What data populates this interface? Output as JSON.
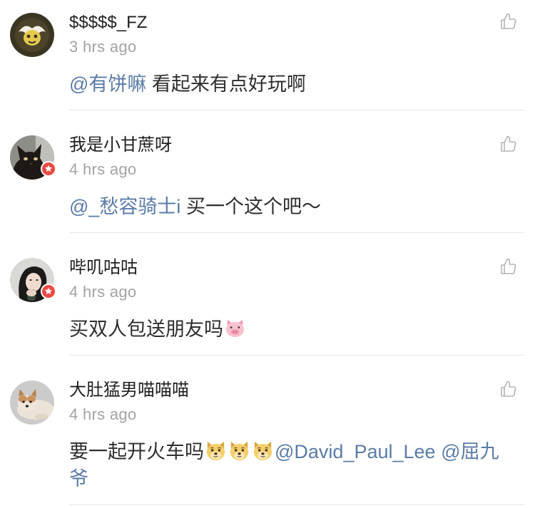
{
  "colors": {
    "mention": "#5a7ba8",
    "username": "#1f1f1f",
    "time": "#a3a3a3",
    "text": "#2e2e2e",
    "divider": "#e6e6e6",
    "badge": "#ea4a43"
  },
  "icons": {
    "like": "thumbs-up-icon",
    "verified": "verified-star-icon"
  },
  "comments": [
    {
      "username": "$$$$$_FZ",
      "time": "3 hrs ago",
      "verified": false,
      "body": [
        {
          "kind": "mention",
          "text": "@有饼嘛"
        },
        {
          "kind": "text",
          "text": " 看起来有点好玩啊"
        }
      ]
    },
    {
      "username": "我是小甘蔗呀",
      "time": "4 hrs ago",
      "verified": true,
      "body": [
        {
          "kind": "mention",
          "text": "@_愁容骑士i"
        },
        {
          "kind": "text",
          "text": " 买一个这个吧～"
        }
      ]
    },
    {
      "username": "哔叽咕咕",
      "time": "4 hrs ago",
      "verified": true,
      "body": [
        {
          "kind": "text",
          "text": "买双人包送朋友吗"
        },
        {
          "kind": "emoji",
          "name": "pig-emoji"
        }
      ]
    },
    {
      "username": "大肚猛男喵喵喵",
      "time": "4 hrs ago",
      "verified": false,
      "body": [
        {
          "kind": "text",
          "text": "要一起开火车吗"
        },
        {
          "kind": "emoji",
          "name": "doge-emoji"
        },
        {
          "kind": "emoji",
          "name": "doge-emoji"
        },
        {
          "kind": "emoji",
          "name": "doge-emoji"
        },
        {
          "kind": "mention",
          "text": "@David_Paul_Lee"
        },
        {
          "kind": "text",
          "text": " "
        },
        {
          "kind": "mention",
          "text": "@屈九爷"
        }
      ]
    }
  ]
}
